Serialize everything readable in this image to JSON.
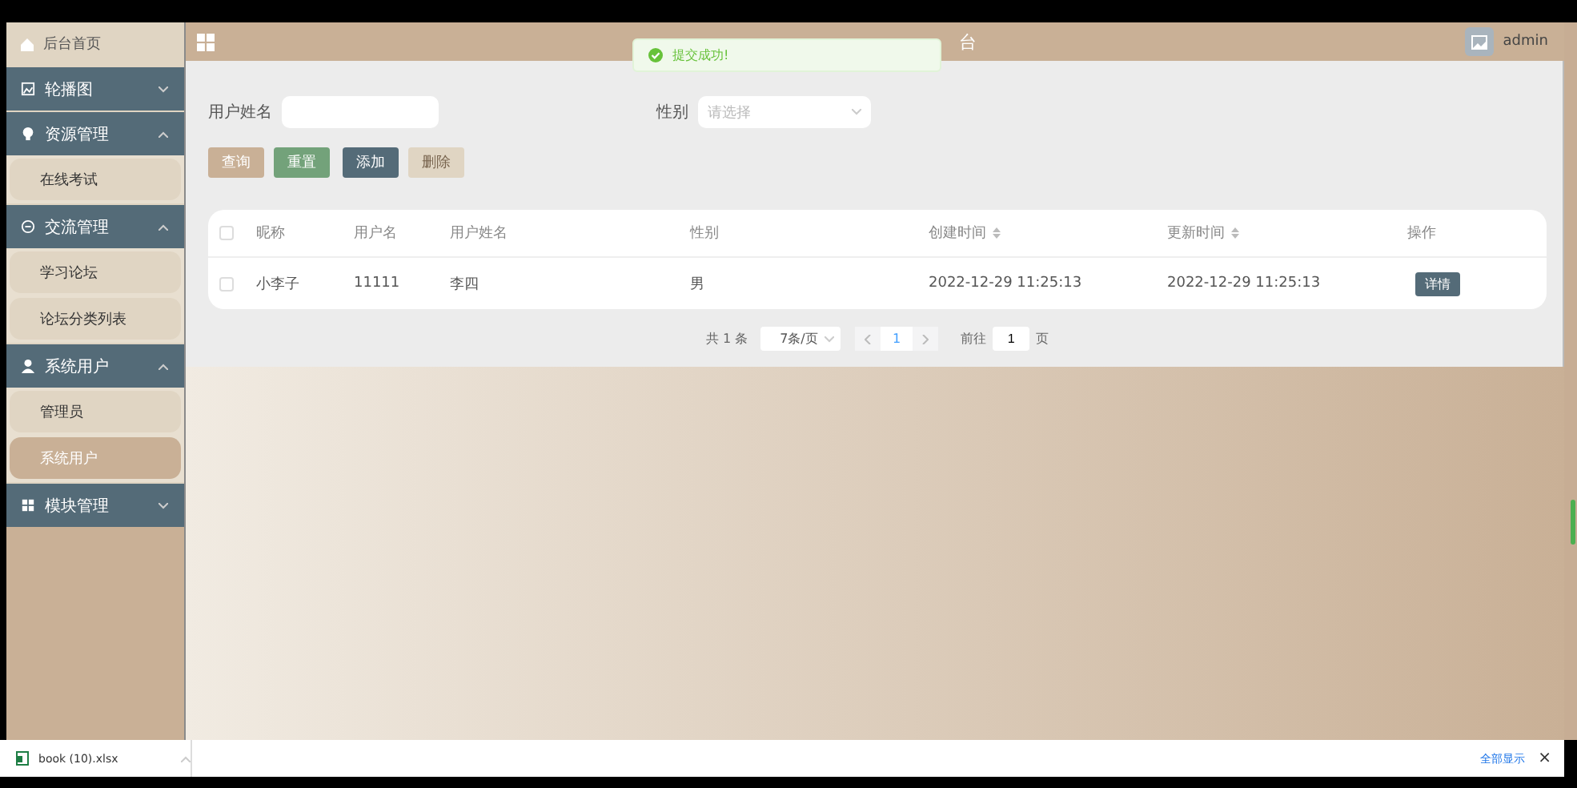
{
  "sidebar": {
    "items": [
      {
        "label": "后台首页",
        "kind": "home",
        "selected": false
      },
      {
        "label": "轮播图",
        "kind": "group",
        "expanded": false
      },
      {
        "label": "资源管理",
        "kind": "group",
        "expanded": true,
        "children": [
          {
            "label": "在线考试",
            "selected": false
          }
        ]
      },
      {
        "label": "交流管理",
        "kind": "group",
        "expanded": true,
        "children": [
          {
            "label": "学习论坛",
            "selected": false
          },
          {
            "label": "论坛分类列表",
            "selected": false
          }
        ]
      },
      {
        "label": "系统用户",
        "kind": "group",
        "expanded": true,
        "children": [
          {
            "label": "管理员",
            "selected": false
          },
          {
            "label": "系统用户",
            "selected": true
          }
        ]
      },
      {
        "label": "模块管理",
        "kind": "group",
        "expanded": false
      }
    ]
  },
  "header": {
    "title": "台",
    "user": "admin"
  },
  "toast": {
    "message": "提交成功!"
  },
  "search": {
    "fields": [
      {
        "label": "用户姓名",
        "kind": "input"
      },
      {
        "label": "性别",
        "kind": "select",
        "placeholder": "请选择"
      }
    ],
    "buttons": [
      {
        "label": "查询",
        "kind": "query",
        "disabled": false
      },
      {
        "label": "重置",
        "kind": "reset",
        "disabled": false
      },
      {
        "label": "添加",
        "kind": "add",
        "disabled": false
      },
      {
        "label": "删除",
        "kind": "delete",
        "disabled": true
      }
    ]
  },
  "table": {
    "all_checked": false,
    "columns": [
      {
        "label": "昵称",
        "sortable": false
      },
      {
        "label": "用户名",
        "sortable": false
      },
      {
        "label": "用户姓名",
        "sortable": false
      },
      {
        "label": "性别",
        "sortable": false
      },
      {
        "label": "创建时间",
        "sortable": true
      },
      {
        "label": "更新时间",
        "sortable": true
      },
      {
        "label": "操作",
        "sortable": false
      }
    ],
    "rows": [
      {
        "checked": false,
        "cells": [
          "小李子",
          "11111",
          "李四",
          "男",
          "2022-12-29 11:25:13",
          "2022-12-29 11:25:13"
        ],
        "action": "详情"
      }
    ]
  },
  "pagination": {
    "total": "共 1 条",
    "page_size": "7条/页",
    "pages": [
      {
        "label": "1",
        "selected": true
      }
    ],
    "goto_label": "前往",
    "goto_value": "1",
    "goto_suffix": "页"
  },
  "download_bar": {
    "file": "book (10).xlsx",
    "show_all": "全部显示",
    "close": "×"
  }
}
